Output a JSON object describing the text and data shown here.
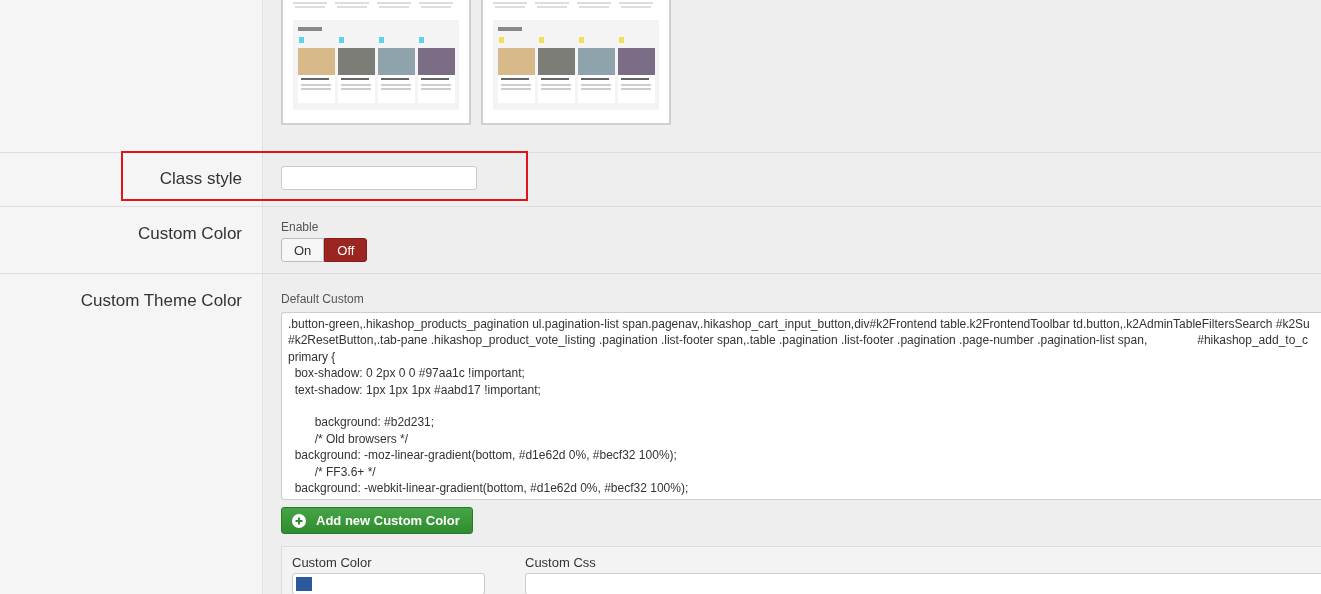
{
  "template_previews": [
    {
      "color": "#5bd3e8"
    },
    {
      "color": "#f0e25a"
    }
  ],
  "class_style": {
    "label": "Class style",
    "highlighted": true
  },
  "custom_color": {
    "label": "Custom Color",
    "enable_label": "Enable",
    "options": [
      {
        "label": "On",
        "selected": false
      },
      {
        "label": "Off",
        "selected": true
      }
    ]
  },
  "custom_theme_color": {
    "label": "Custom Theme Color",
    "default_label": "Default Custom",
    "default_css": ".button-green,.hikashop_products_pagination ul.pagination-list span.pagenav,.hikashop_cart_input_button,div#k2Frontend table.k2FrontendToolbar td.button,.k2AdminTableFiltersSearch #k2Su\n#k2ResetButton,.tab-pane .hikashop_product_vote_listing .pagination .list-footer span,.table .pagination .list-footer .pagination .page-number .pagination-list span,               #hikashop_add_to_c\nprimary {\n  box-shadow: 0 2px 0 0 #97aa1c !important;\n  text-shadow: 1px 1px 1px #aabd17 !important;\n\n        background: #b2d231;\n        /* Old browsers */\n  background: -moz-linear-gradient(bottom, #d1e62d 0%, #becf32 100%);\n        /* FF3.6+ */\n  background: -webkit-linear-gradient(bottom, #d1e62d 0%, #becf32 100%);",
    "add_button": "Add new Custom Color",
    "columns": [
      {
        "label": "Custom Color",
        "kind": "color"
      },
      {
        "label": "Custom Css",
        "kind": "css"
      }
    ],
    "swatches": [
      {
        "color": "#2a5a9a"
      }
    ]
  }
}
